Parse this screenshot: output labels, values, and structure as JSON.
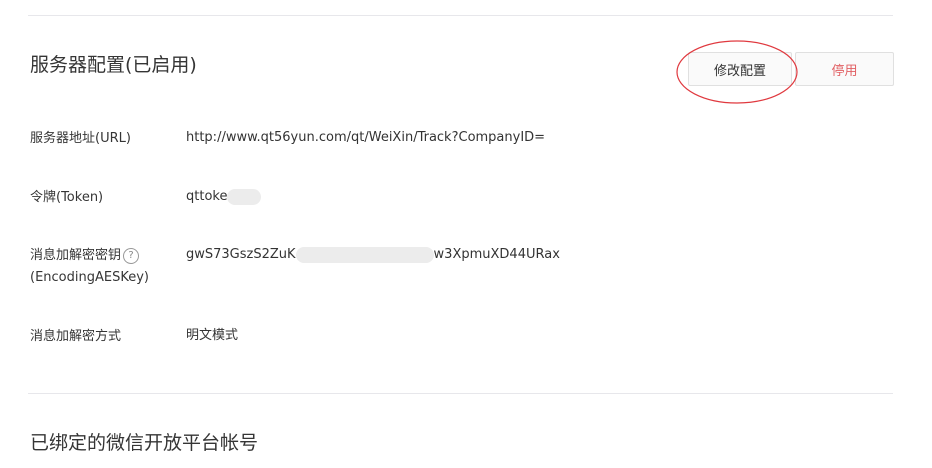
{
  "server_config": {
    "title": "服务器配置(已启用)",
    "edit_button": "修改配置",
    "disable_button": "停用",
    "rows": [
      {
        "label": "服务器地址(URL)",
        "value": "http://www.qt56yun.com/qt/WeiXin/Track?CompanyID="
      },
      {
        "label": "令牌(Token)",
        "value_visible": "qttoke"
      },
      {
        "label_line1": "消息加解密密钥",
        "label_line2": "(EncodingAESKey)",
        "value_start": "gwS73GszS2ZuK",
        "value_end": "w3XpmuXD44URax"
      },
      {
        "label": "消息加解密方式",
        "value": "明文模式"
      }
    ]
  },
  "bound_accounts": {
    "title": "已绑定的微信开放平台帐号"
  },
  "colors": {
    "annotation": "#e0393f",
    "disable_text": "#e15f63",
    "divider": "#e7e7eb"
  },
  "icons": {
    "help": "question-circle-icon"
  }
}
